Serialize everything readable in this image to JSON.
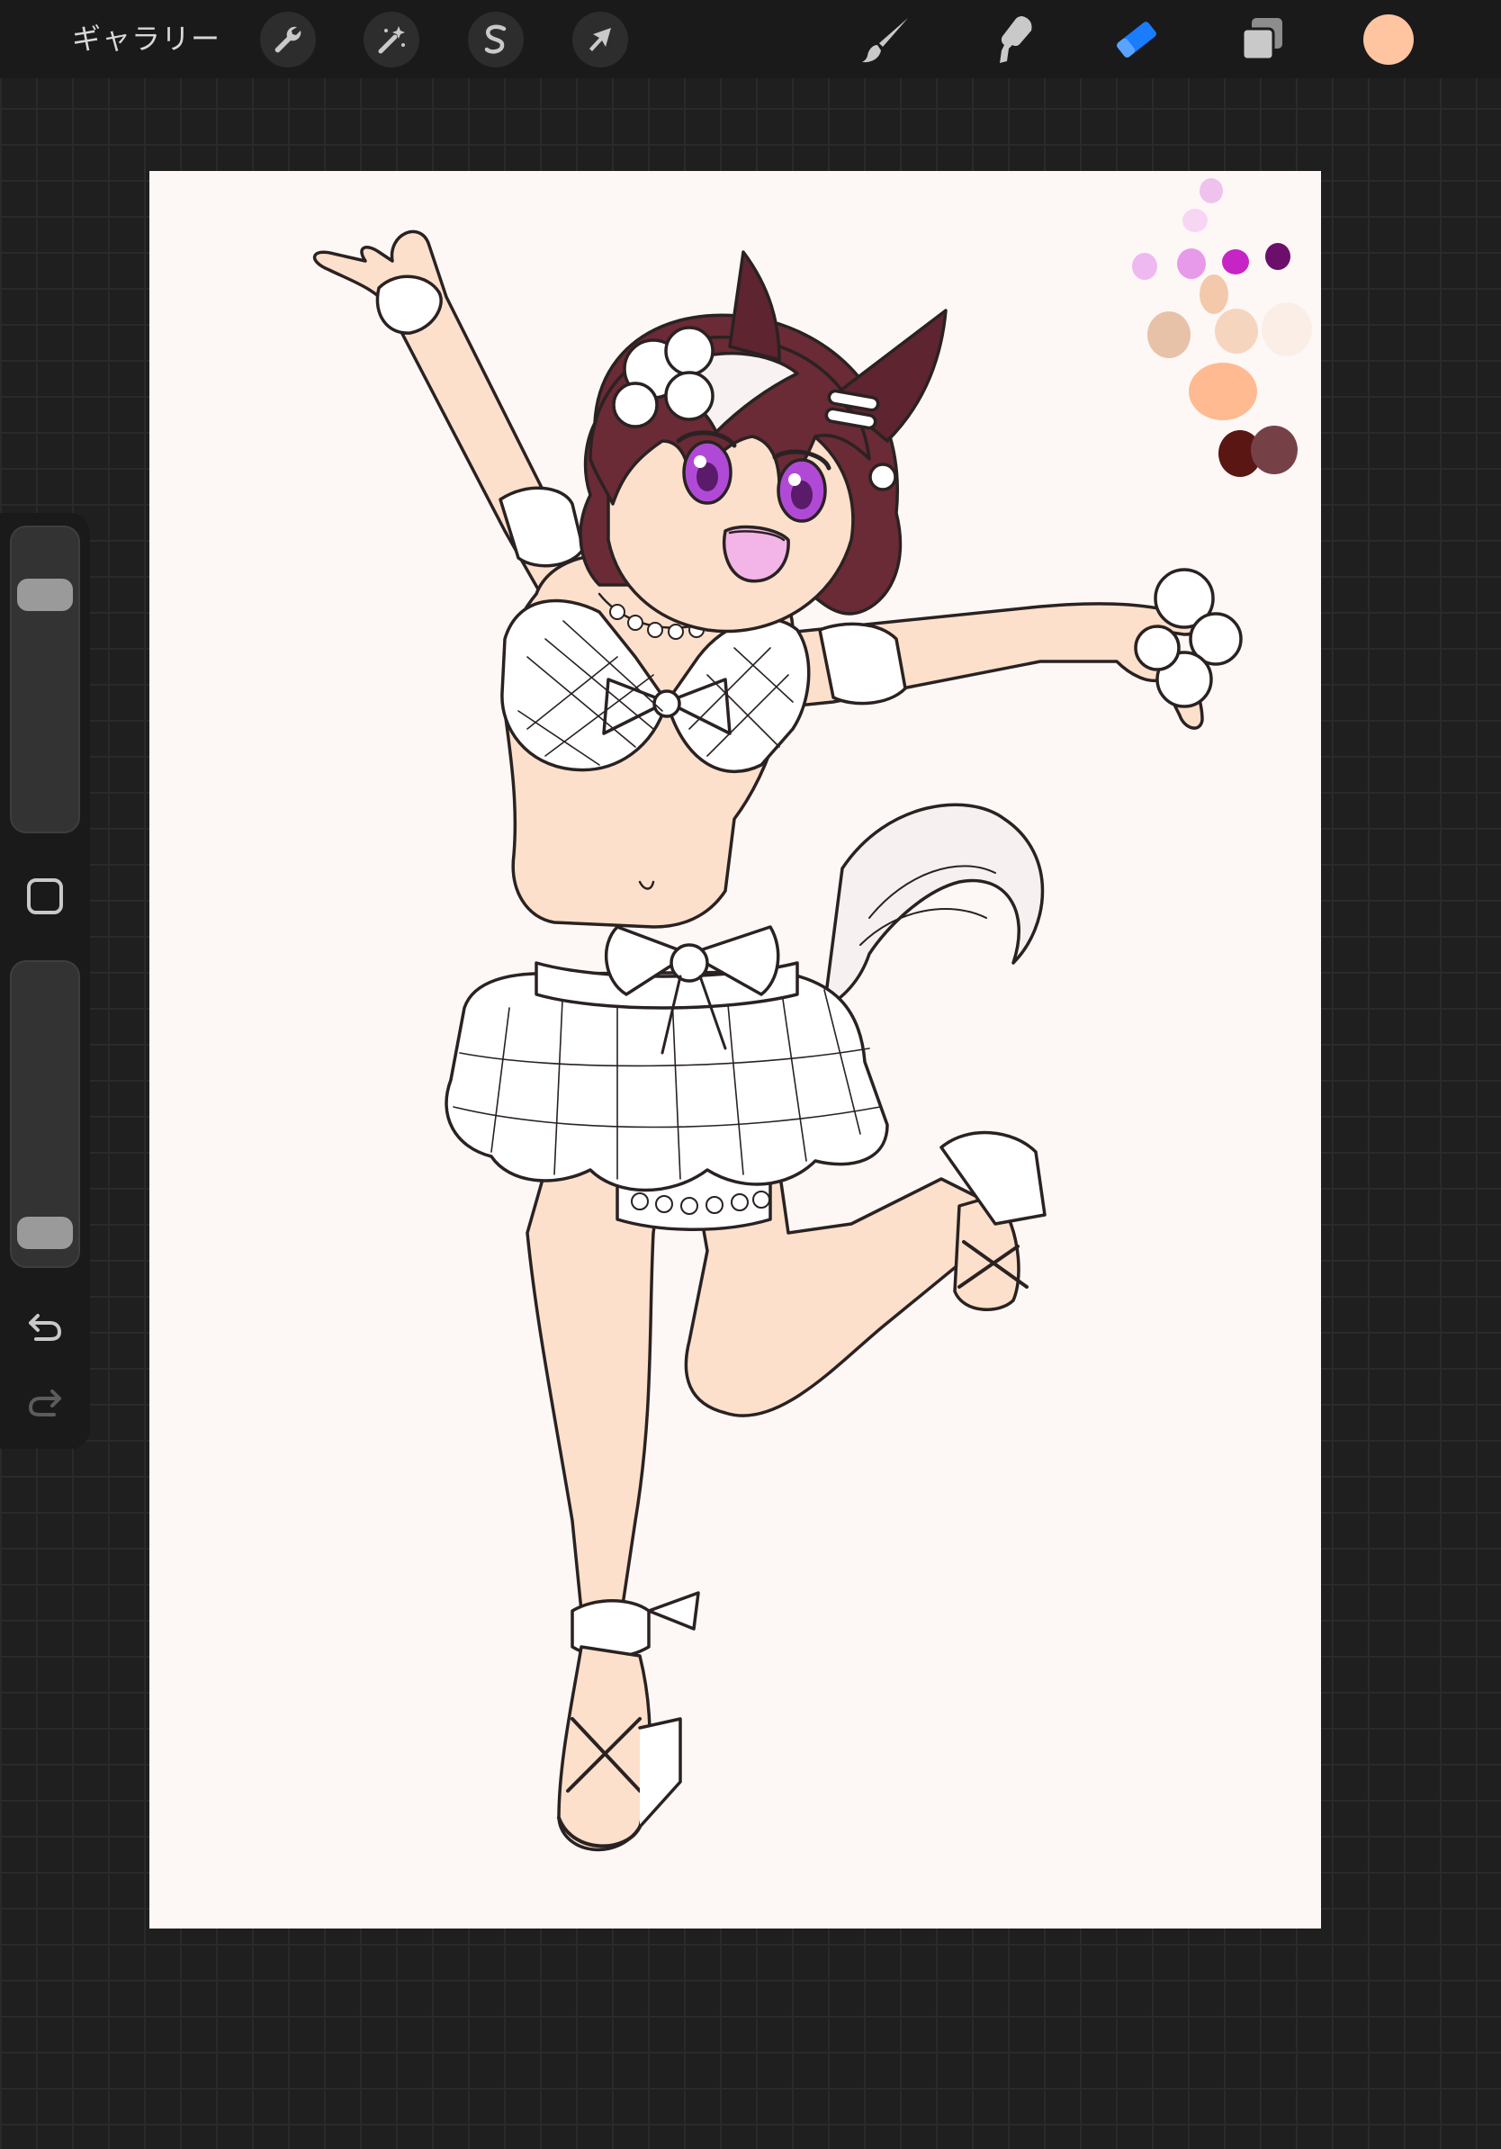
{
  "toolbar": {
    "gallery_label": "ギャラリー",
    "left_tools": [
      {
        "name": "actions-wrench-icon"
      },
      {
        "name": "adjustments-magic-wand-icon"
      },
      {
        "name": "selection-s-icon"
      },
      {
        "name": "transform-arrow-icon"
      }
    ],
    "right_tools": [
      {
        "name": "brush-icon",
        "active": false
      },
      {
        "name": "smudge-icon",
        "active": false
      },
      {
        "name": "eraser-icon",
        "active": true
      },
      {
        "name": "layers-icon",
        "active": false
      }
    ],
    "current_color": "#ffc4a0"
  },
  "colors": {
    "accent": "#1a7cff",
    "icon": "#c9c9c9",
    "skin": "#fde0cc",
    "hair": "#6a2a36",
    "eyes": "#b04ad6",
    "line": "#2a2222"
  },
  "canvas": {
    "background": "#fdf8f6",
    "palette_swatches": [
      "#efc2ee",
      "#f7d6f3",
      "#eeb9f0",
      "#e79ae9",
      "#c724c5",
      "#6b0f6a",
      "#f4c9ab",
      "#e8c2a8",
      "#f6d5bf",
      "#fbeee6",
      "#ffba91",
      "#5a1613",
      "#754147"
    ]
  },
  "sidebar": {
    "brush_size_level": 0.83,
    "opacity_level": 0.04,
    "modify_icon": "modify-square-icon",
    "undo_icon": "undo-icon",
    "redo_icon": "redo-icon"
  }
}
